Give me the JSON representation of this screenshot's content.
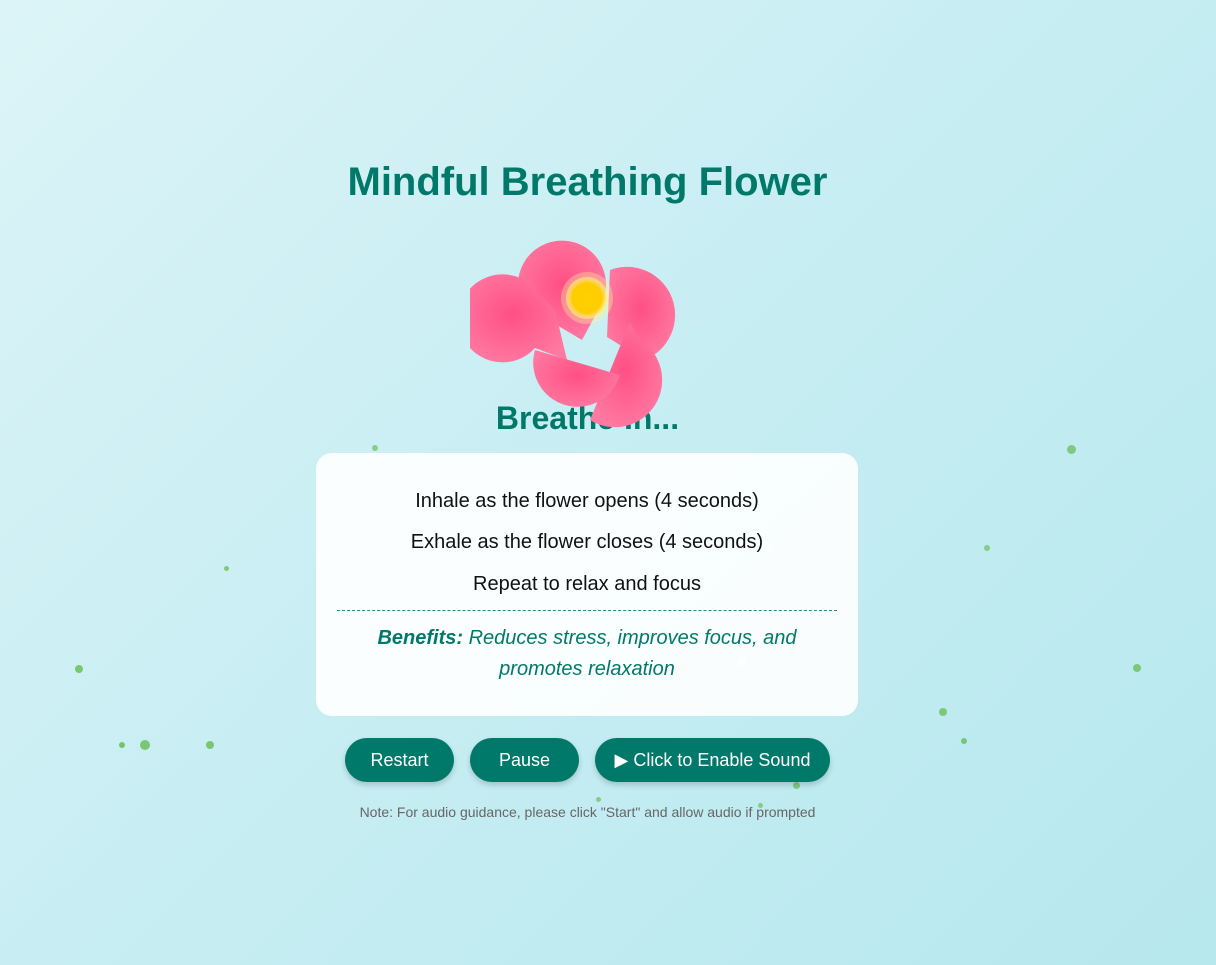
{
  "title": "Mindful Breathing Flower",
  "phase": "Breathe In...",
  "instructions": [
    "Inhale as the flower opens (4 seconds)",
    "Exhale as the flower closes (4 seconds)",
    "Repeat to relax and focus"
  ],
  "benefits": {
    "label": "Benefits:",
    "text": "Reduces stress, improves focus, and promotes relaxation"
  },
  "buttons": {
    "restart": "Restart",
    "pause": "Pause",
    "sound": "▶ Click to Enable Sound"
  },
  "note": "Note: For audio guidance, please click \"Start\" and allow audio if prompted",
  "colors": {
    "accent": "#00796b",
    "petal": "#ff5c8d",
    "center": "#ffd700",
    "particle": "#6bbf5a"
  }
}
